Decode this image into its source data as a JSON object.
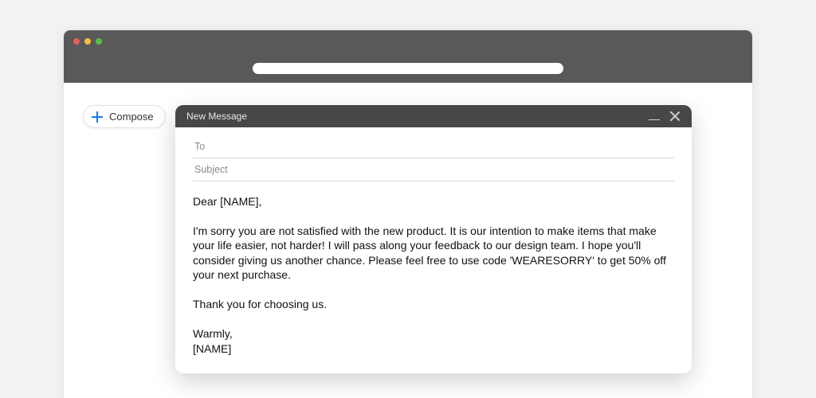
{
  "sidebar": {
    "compose_label": "Compose"
  },
  "compose": {
    "title": "New Message",
    "to_placeholder": "To",
    "to_value": "",
    "subject_placeholder": "Subject",
    "subject_value": "",
    "body": "Dear [NAME],\n\nI'm sorry you are not satisfied with the new product. It is our intention to make items that make your life easier, not harder! I will pass along your feedback to our design team. I hope you'll consider giving us another chance. Please feel free to use code 'WEARESORRY' to get 50% off your next purchase.\n\nThank you for choosing us.\n\nWarmly,\n[NAME]"
  }
}
